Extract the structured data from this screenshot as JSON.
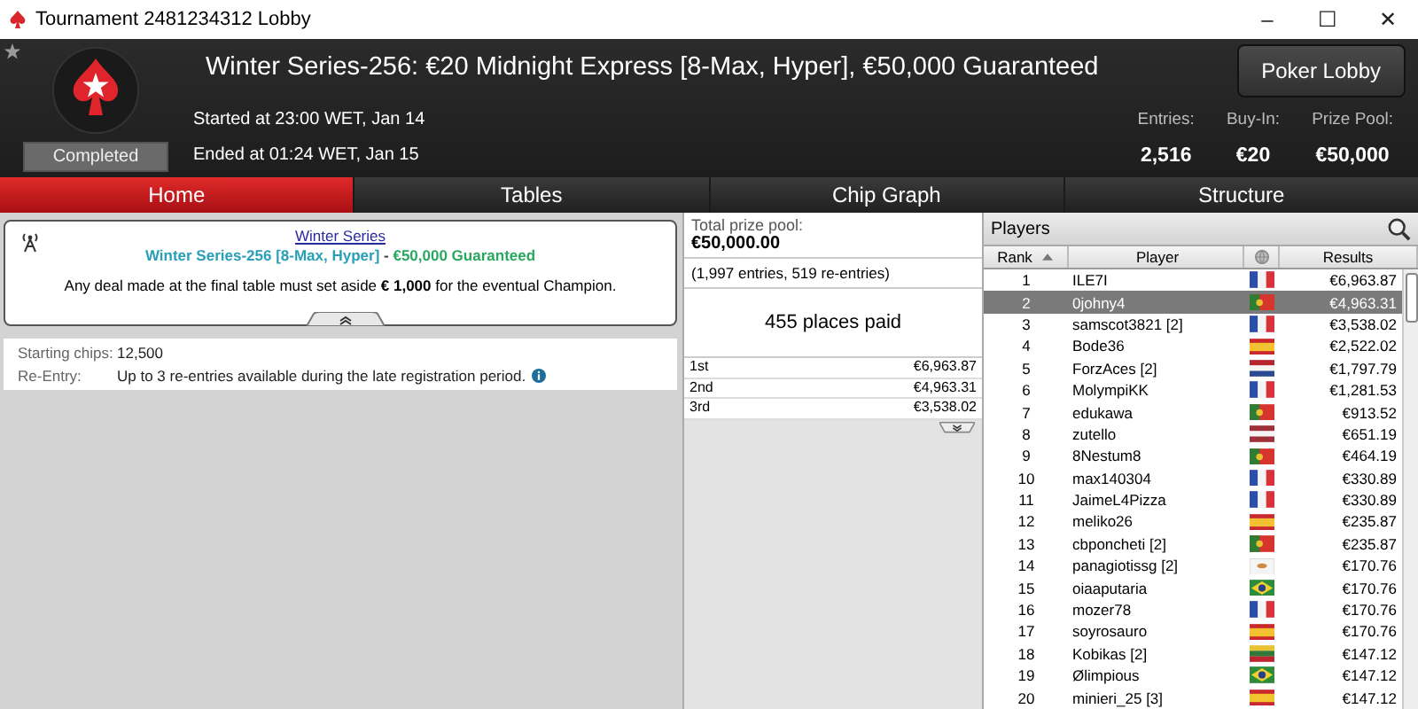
{
  "window": {
    "title": "Tournament 2481234312 Lobby",
    "controls": [
      "–",
      "☐",
      "✕"
    ]
  },
  "header": {
    "title": "Winter Series-256: €20 Midnight Express [8-Max, Hyper], €50,000 Guaranteed",
    "status": "Completed",
    "started": "Started at 23:00 WET, Jan 14",
    "ended": "Ended at 01:24 WET, Jan 15",
    "lobby_button": "Poker Lobby",
    "stats": [
      {
        "label": "Entries:",
        "value": "2,516"
      },
      {
        "label": "Buy-In:",
        "value": "€20"
      },
      {
        "label": "Prize Pool:",
        "value": "€50,000"
      }
    ]
  },
  "tabs": [
    {
      "label": "Home",
      "selected": true
    },
    {
      "label": "Tables",
      "selected": false
    },
    {
      "label": "Chip Graph",
      "selected": false
    },
    {
      "label": "Structure",
      "selected": false
    }
  ],
  "info": {
    "link": "Winter Series",
    "subtitle": "Winter Series-256 [8-Max, Hyper]",
    "separator": " - ",
    "guarantee": "€50,000 Guaranteed",
    "note": "Any deal made at the final table must set aside **€ 1,000** for the eventual Champion."
  },
  "details": [
    {
      "label": "Starting chips:",
      "value": "12,500",
      "info": false
    },
    {
      "label": "Re-Entry:",
      "value": "Up to 3 re-entries available during the late registration period.",
      "info": true
    }
  ],
  "prizes": {
    "label": "Total prize pool:",
    "total": "€50,000.00",
    "entries": "(1,997 entries, 519 re-entries)",
    "places": "455 places paid",
    "rows": [
      {
        "place": "1st",
        "amount": "€6,963.87"
      },
      {
        "place": "2nd",
        "amount": "€4,963.31"
      },
      {
        "place": "3rd",
        "amount": "€3,538.02"
      }
    ]
  },
  "players": {
    "title": "Players",
    "columns": [
      "Rank",
      "Player",
      "Results"
    ],
    "rows": [
      {
        "rank": "1",
        "name": "ILE7I",
        "flag": {
          "kind": "fr"
        },
        "result": "€6,963.87",
        "selected": false
      },
      {
        "rank": "2",
        "name": "0johny4",
        "flag": {
          "kind": "pt"
        },
        "result": "€4,963.31",
        "selected": true
      },
      {
        "rank": "3",
        "name": "samscot3821 [2]",
        "flag": {
          "kind": "fr"
        },
        "result": "€3,538.02",
        "selected": false
      },
      {
        "rank": "4",
        "name": "Bode36",
        "flag": {
          "kind": "es"
        },
        "result": "€2,522.02",
        "selected": false
      },
      {
        "rank": "5",
        "name": "ForzAces [2]",
        "flag": {
          "kind": "nl"
        },
        "result": "€1,797.79",
        "selected": false
      },
      {
        "rank": "6",
        "name": "MolympiKK",
        "flag": {
          "kind": "fr"
        },
        "result": "€1,281.53",
        "selected": false
      },
      {
        "rank": "7",
        "name": "edukawa",
        "flag": {
          "kind": "pt"
        },
        "result": "€913.52",
        "selected": false
      },
      {
        "rank": "8",
        "name": "zutello",
        "flag": {
          "kind": "lv"
        },
        "result": "€651.19",
        "selected": false
      },
      {
        "rank": "9",
        "name": "8Nestum8",
        "flag": {
          "kind": "pt"
        },
        "result": "€464.19",
        "selected": false
      },
      {
        "rank": "10",
        "name": "max140304",
        "flag": {
          "kind": "fr"
        },
        "result": "€330.89",
        "selected": false
      },
      {
        "rank": "11",
        "name": "JaimeL4Pizza",
        "flag": {
          "kind": "fr"
        },
        "result": "€330.89",
        "selected": false
      },
      {
        "rank": "12",
        "name": "meliko26",
        "flag": {
          "kind": "es"
        },
        "result": "€235.87",
        "selected": false
      },
      {
        "rank": "13",
        "name": "cbponcheti [2]",
        "flag": {
          "kind": "pt"
        },
        "result": "€235.87",
        "selected": false
      },
      {
        "rank": "14",
        "name": "panagiotissg [2]",
        "flag": {
          "kind": "cy"
        },
        "result": "€170.76",
        "selected": false
      },
      {
        "rank": "15",
        "name": "oiaaputaria",
        "flag": {
          "kind": "br"
        },
        "result": "€170.76",
        "selected": false
      },
      {
        "rank": "16",
        "name": "mozer78",
        "flag": {
          "kind": "fr"
        },
        "result": "€170.76",
        "selected": false
      },
      {
        "rank": "17",
        "name": "soyrosauro",
        "flag": {
          "kind": "es"
        },
        "result": "€170.76",
        "selected": false
      },
      {
        "rank": "18",
        "name": "Kobikas [2]",
        "flag": {
          "kind": "lt"
        },
        "result": "€147.12",
        "selected": false
      },
      {
        "rank": "19",
        "name": "Ølimpious",
        "flag": {
          "kind": "br"
        },
        "result": "€147.12",
        "selected": false
      },
      {
        "rank": "20",
        "name": "minieri_25 [3]",
        "flag": {
          "kind": "es"
        },
        "result": "€147.12",
        "selected": false
      }
    ]
  }
}
